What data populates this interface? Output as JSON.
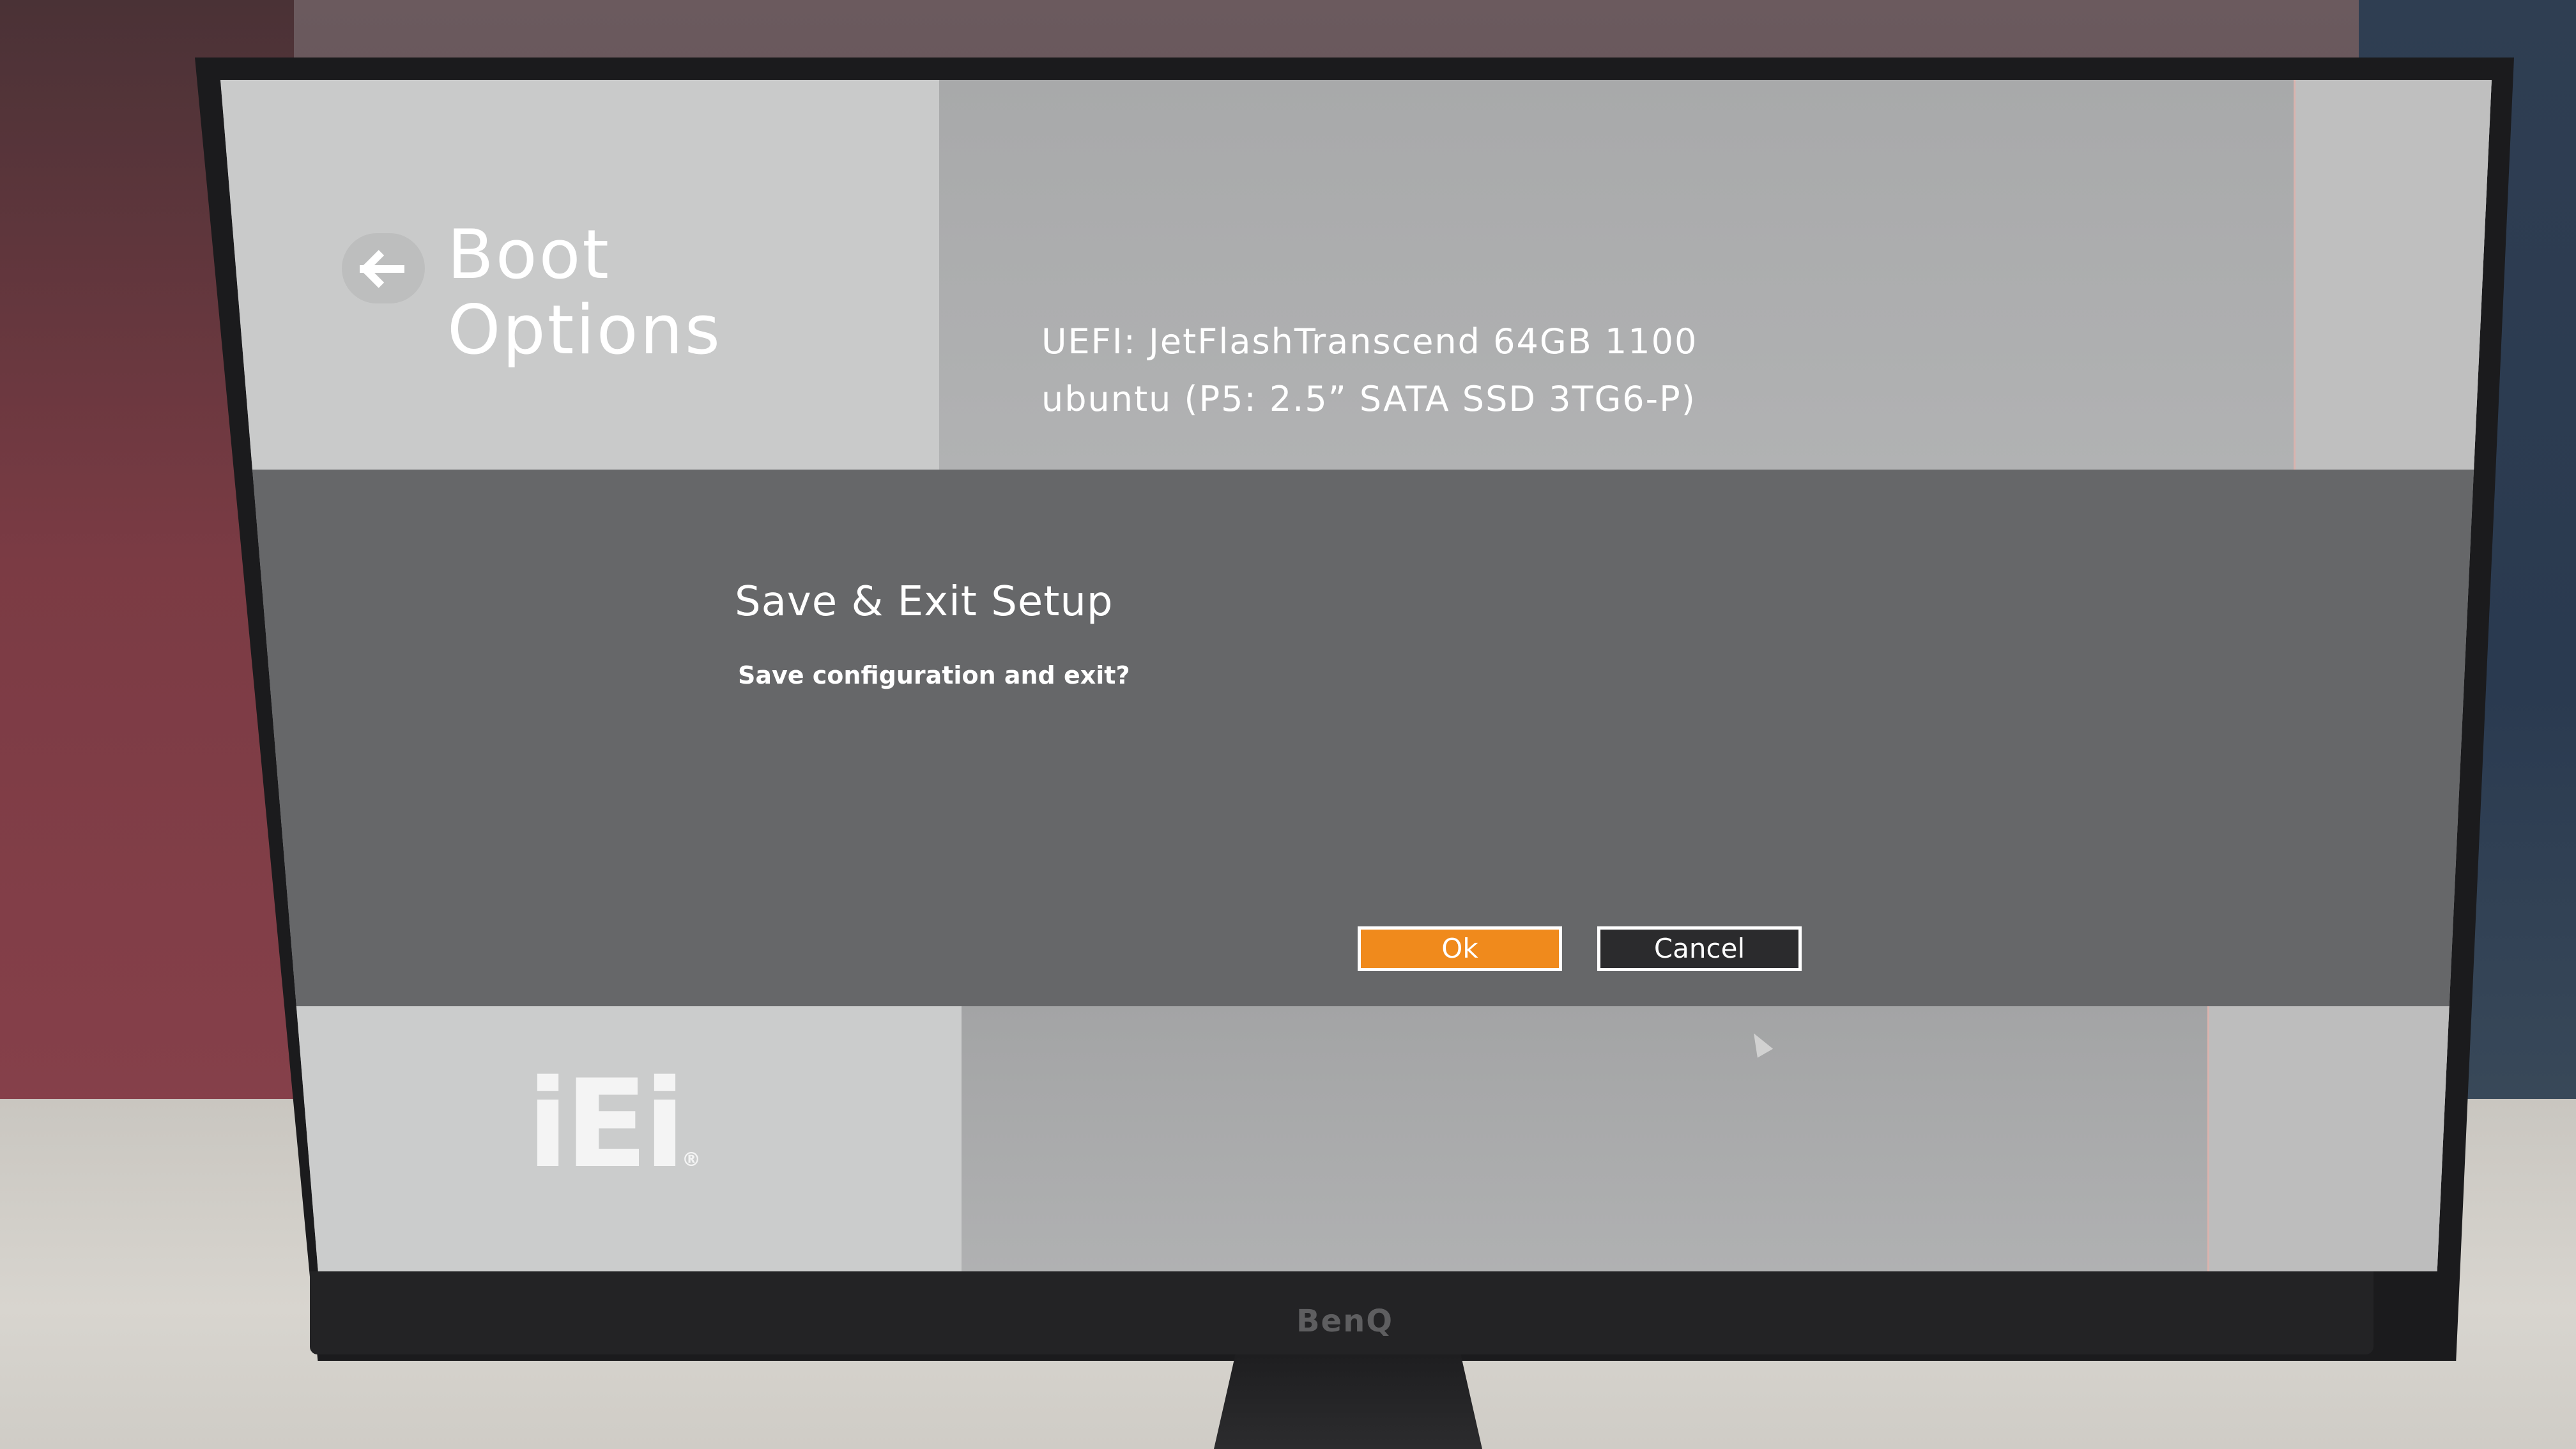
{
  "page": {
    "title": "Boot Options"
  },
  "boot_options": [
    "UEFI: JetFlashTranscend 64GB 1100",
    "ubuntu (P5: 2.5” SATA SSD 3TG6-P)"
  ],
  "dialog": {
    "title": "Save & Exit Setup",
    "message": "Save configuration and exit?",
    "ok_label": "Ok",
    "cancel_label": "Cancel"
  },
  "branding": {
    "logo_text": "iEi",
    "logo_mark": "®",
    "monitor_brand": "BenQ"
  },
  "icons": {
    "back": "back-arrow-icon",
    "cursor": "mouse-cursor-icon"
  },
  "colors": {
    "ok_button": "#f08a1c",
    "cancel_button": "#2b2b2d",
    "dialog_background": "#666769",
    "header_left": "#c9caca",
    "header_right": "#a8a9aa"
  }
}
